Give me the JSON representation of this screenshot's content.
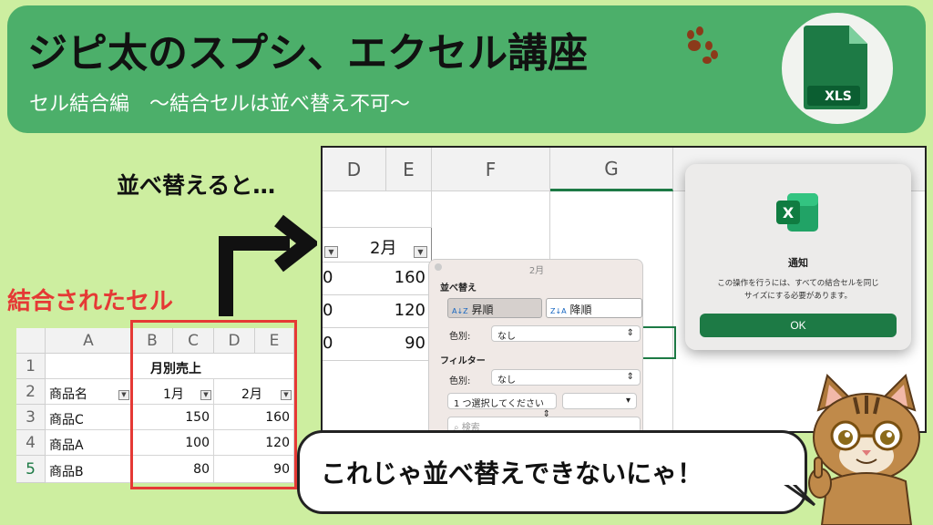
{
  "banner": {
    "title": "ジピ太のスプシ、エクセル講座",
    "subtitle": "セル結合編　～結合セルは並べ替え不可～",
    "badge_label": "XLS",
    "accent": "#4caf6a"
  },
  "arrow_caption": "並べ替えると…",
  "merged_caption": "結合されたセル",
  "screenshot": {
    "columns": [
      "D",
      "E",
      "F",
      "G"
    ],
    "header_cell": "2月",
    "values": [
      "160",
      "120",
      "90"
    ],
    "left_values": [
      "0",
      "0",
      "0"
    ]
  },
  "sort_panel": {
    "title": "2月",
    "sort_heading": "並べ替え",
    "asc_label": "昇順",
    "desc_label": "降順",
    "color_label": "色別:",
    "color_value": "なし",
    "filter_heading": "フィルター",
    "filter_color_label": "色別:",
    "filter_color_value": "なし",
    "choose_placeholder": "1 つ選択してください",
    "search_placeholder": "検索"
  },
  "dialog": {
    "title": "通知",
    "message_line1": "この操作を行うには、すべての結合セルを同じ",
    "message_line2": "サイズにする必要があります。",
    "ok_label": "OK"
  },
  "small_sheet": {
    "columns": [
      "A",
      "B",
      "C",
      "D",
      "E"
    ],
    "row_numbers": [
      "1",
      "2",
      "3",
      "4",
      "5"
    ],
    "merged_title": "月別売上",
    "headers": [
      "商品名",
      "1月",
      "2月"
    ],
    "rows": [
      {
        "name": "商品C",
        "jan": "150",
        "feb": "160"
      },
      {
        "name": "商品A",
        "jan": "100",
        "feb": "120"
      },
      {
        "name": "商品B",
        "jan": "80",
        "feb": "90"
      }
    ]
  },
  "bubble_text": "これじゃ並べ替えできないにゃ！",
  "colors": {
    "background": "#cdeea0",
    "highlight_red": "#e53935",
    "excel_green": "#1d7a45"
  }
}
